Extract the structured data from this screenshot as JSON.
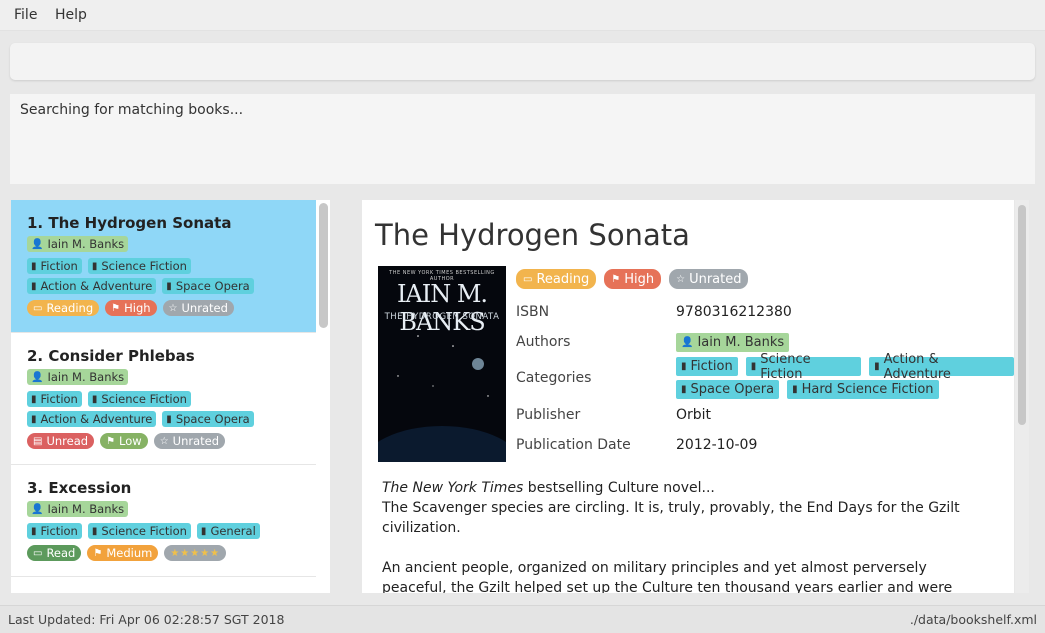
{
  "menu": {
    "file": "File",
    "help": "Help"
  },
  "command_box": {
    "value": ""
  },
  "result_display": {
    "text": "Searching for matching books..."
  },
  "books": [
    {
      "title": "1. The Hydrogen Sonata",
      "author": "Iain M. Banks",
      "categories_row1": [
        "Fiction",
        "Science Fiction"
      ],
      "categories_row2": [
        "Action & Adventure",
        "Space Opera"
      ],
      "status": "Reading",
      "priority": "High",
      "rating": "Unrated"
    },
    {
      "title": "2. Consider Phlebas",
      "author": "Iain M. Banks",
      "categories_row1": [
        "Fiction",
        "Science Fiction"
      ],
      "categories_row2": [
        "Action & Adventure",
        "Space Opera"
      ],
      "status": "Unread",
      "priority": "Low",
      "rating": "Unrated"
    },
    {
      "title": "3. Excession",
      "author": "Iain M. Banks",
      "categories_row1": [
        "Fiction",
        "Science Fiction",
        "General"
      ],
      "status": "Read",
      "priority": "Medium",
      "rating": "★★★★★"
    }
  ],
  "details": {
    "title": "The Hydrogen Sonata",
    "cover": {
      "nyt": "THE NEW YORK TIMES BESTSELLING AUTHOR",
      "author": "IAIN M. BANKS",
      "subtitle": "THE HYDROGEN SONATA"
    },
    "status": "Reading",
    "priority": "High",
    "rating": "Unrated",
    "isbn_label": "ISBN",
    "isbn": "9780316212380",
    "authors_label": "Authors",
    "author": "Iain M. Banks",
    "categories_label": "Categories",
    "categories_row1": [
      "Fiction",
      "Science Fiction",
      "Action & Adventure"
    ],
    "categories_row2": [
      "Space Opera",
      "Hard Science Fiction"
    ],
    "publisher_label": "Publisher",
    "publisher": "Orbit",
    "pubdate_label": "Publication Date",
    "pubdate": "2012-10-09",
    "desc_italic": "The New York Times",
    "desc_line1_rest": " bestselling Culture novel...",
    "desc_line2": "The Scavenger species are circling. It is, truly, provably, the End Days for the Gzilt civilization.",
    "desc_para2": "An ancient people, organized on military principles and yet almost perversely peaceful, the Gzilt helped set up the Culture ten thousand years earlier and were very nearly one of"
  },
  "status_bar": {
    "last_updated": "Last Updated: Fri Apr 06 02:28:57 SGT 2018",
    "file_path": "./data/bookshelf.xml"
  },
  "colors": {
    "selected": "#8fd7f7",
    "author": "#a6d69a",
    "category": "#5fd0de",
    "reading": "#f2b44d",
    "high": "#e67258",
    "unrated": "#a0a7ad",
    "unread": "#db6161",
    "low": "#86b264",
    "read": "#5c9a5c",
    "medium": "#f2a23c"
  },
  "icons": {
    "author": "person-icon",
    "category": "book-icon",
    "reading": "open-book-icon",
    "priority": "flag-icon",
    "rating": "star-icon",
    "unread": "closed-book-icon"
  }
}
